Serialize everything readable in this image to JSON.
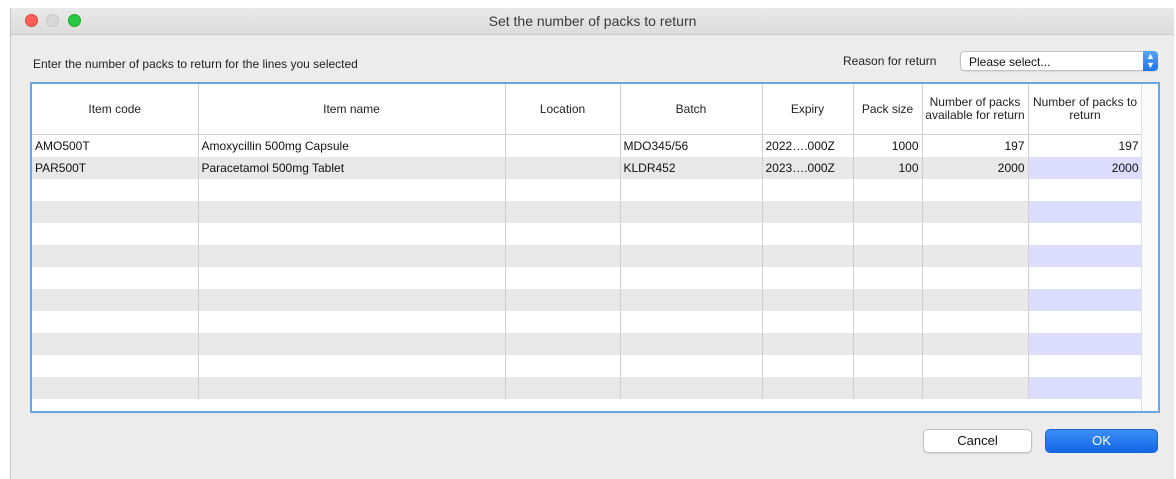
{
  "window": {
    "title": "Set the number of packs to return"
  },
  "instructions": "Enter the number of packs to return for the lines you selected",
  "reason": {
    "label": "Reason for return",
    "value": "Please select..."
  },
  "table": {
    "columns": [
      "Item code",
      "Item name",
      "Location",
      "Batch",
      "Expiry",
      "Pack size",
      "Number of packs available for return",
      "Number of packs to return"
    ],
    "rows": [
      {
        "code": "AMO500T",
        "name": "Amoxycillin 500mg Capsule",
        "location": "",
        "batch": "MDO345/56",
        "expiry": "2022….000Z",
        "pack_size": "1000",
        "available": "197",
        "to_return": "197"
      },
      {
        "code": "PAR500T",
        "name": "Paracetamol 500mg Tablet",
        "location": "",
        "batch": "KLDR452",
        "expiry": "2023….000Z",
        "pack_size": "100",
        "available": "2000",
        "to_return": "2000"
      }
    ]
  },
  "buttons": {
    "cancel": "Cancel",
    "ok": "OK"
  },
  "colors": {
    "accent": "#1c74ee",
    "selection_border": "#6aa6e3",
    "editable_cell": "#dcdcff"
  }
}
